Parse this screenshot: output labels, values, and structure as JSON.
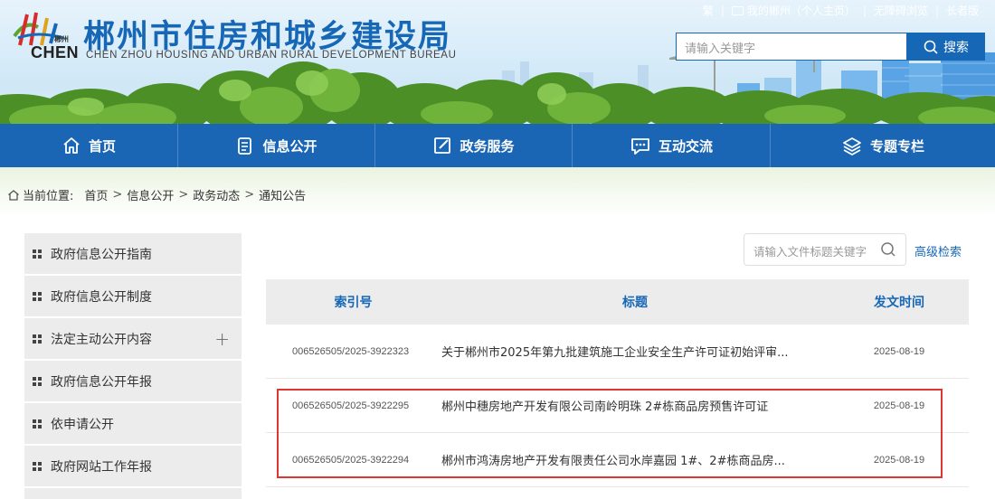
{
  "header": {
    "logo_small_text": "郴州",
    "logo_latin": "CHEN",
    "title": "郴州市住房和城乡建设局",
    "subtitle": "CHEN ZHOU HOUSING AND URBAN RURAL DEVELOPMENT BUREAU",
    "top_links": [
      "繁",
      "我的郴州（个人主页）",
      "无障碍浏览",
      "长者版"
    ],
    "search": {
      "placeholder": "请输入关键字",
      "button": "搜索"
    }
  },
  "nav": {
    "items": [
      {
        "label": "首页",
        "icon": "home-icon"
      },
      {
        "label": "信息公开",
        "icon": "document-icon"
      },
      {
        "label": "政务服务",
        "icon": "edit-icon"
      },
      {
        "label": "互动交流",
        "icon": "chat-icon"
      },
      {
        "label": "专题专栏",
        "icon": "layers-icon"
      }
    ]
  },
  "breadcrumb": {
    "label": "当前位置:",
    "items": [
      "首页",
      "信息公开",
      "政务动态",
      "通知公告"
    ]
  },
  "sidebar": {
    "items": [
      {
        "label": "政府信息公开指南"
      },
      {
        "label": "政府信息公开制度"
      },
      {
        "label": "法定主动公开内容",
        "expandable": true
      },
      {
        "label": "政府信息公开年报"
      },
      {
        "label": "依申请公开"
      },
      {
        "label": "政府网站工作年报"
      }
    ],
    "expand_symbol": "+"
  },
  "main": {
    "doc_search_placeholder": "请输入文件标题关键字",
    "advanced_search": "高级检索",
    "table": {
      "headers": {
        "index": "索引号",
        "title": "标题",
        "date": "发文时间"
      },
      "rows": [
        {
          "index": "006526505/2025-3922323",
          "title": "关于郴州市2025年第九批建筑施工企业安全生产许可证初始评审...",
          "date": "2025-08-19"
        },
        {
          "index": "006526505/2025-3922295",
          "title": "郴州中穗房地产开发有限公司南岭明珠 2#栋商品房预售许可证",
          "date": "2025-08-19"
        },
        {
          "index": "006526505/2025-3922294",
          "title": "郴州市鸿涛房地产开发有限责任公司水岸嘉园 1#、2#栋商品房...",
          "date": "2025-08-19"
        }
      ]
    }
  },
  "colors": {
    "brand_blue": "#1667b6",
    "nav_blue": "#1a66b5",
    "highlight_red": "#e0362f",
    "sidebar_bg": "#ececec"
  }
}
